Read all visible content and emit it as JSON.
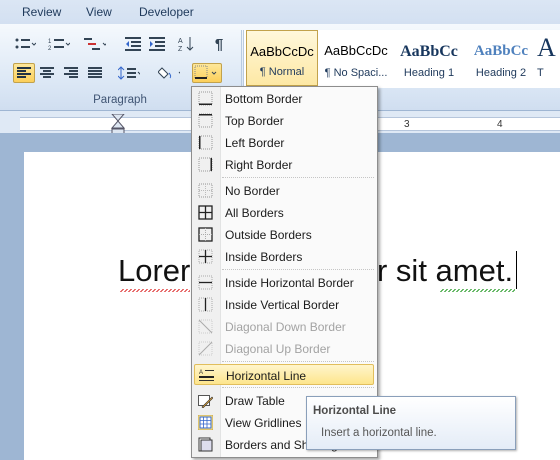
{
  "ribbon": {
    "tabs": [
      "Review",
      "View",
      "Developer"
    ],
    "paragraph_group_label": "Paragraph",
    "styles": [
      {
        "sample": "AaBbCcDc",
        "name": "¶ Normal",
        "selected": true
      },
      {
        "sample": "AaBbCcDc",
        "name": "¶ No Spaci...",
        "selected": false
      },
      {
        "sample": "AaBbCc",
        "name": "Heading 1",
        "selected": false
      },
      {
        "sample": "AaBbCc",
        "name": "Heading 2",
        "selected": false
      },
      {
        "sample": "A",
        "name": "T",
        "selected": false
      }
    ],
    "colors": {
      "heading": "#17365d",
      "heading2": "#4f81bd"
    }
  },
  "ruler": {
    "numbers": [
      "1",
      "3",
      "4"
    ]
  },
  "document": {
    "text_left": "Lorer",
    "text_right": "r sit amet."
  },
  "borders_menu": {
    "items": [
      {
        "label": "Bottom Border",
        "icon": "bottom-border-icon",
        "disabled": false
      },
      {
        "label": "Top Border",
        "icon": "top-border-icon",
        "disabled": false
      },
      {
        "label": "Left Border",
        "icon": "left-border-icon",
        "disabled": false
      },
      {
        "label": "Right Border",
        "icon": "right-border-icon",
        "disabled": false
      },
      {
        "label": "No Border",
        "icon": "no-border-icon",
        "disabled": false
      },
      {
        "label": "All Borders",
        "icon": "all-borders-icon",
        "disabled": false
      },
      {
        "label": "Outside Borders",
        "icon": "outside-borders-icon",
        "disabled": false
      },
      {
        "label": "Inside Borders",
        "icon": "inside-borders-icon",
        "disabled": false
      },
      {
        "label": "Inside Horizontal Border",
        "icon": "inside-horizontal-border-icon",
        "disabled": false
      },
      {
        "label": "Inside Vertical Border",
        "icon": "inside-vertical-border-icon",
        "disabled": false
      },
      {
        "label": "Diagonal Down Border",
        "icon": "diagonal-down-border-icon",
        "disabled": true
      },
      {
        "label": "Diagonal Up Border",
        "icon": "diagonal-up-border-icon",
        "disabled": true
      },
      {
        "label": "Horizontal Line",
        "icon": "horizontal-line-icon",
        "disabled": false,
        "highlighted": true
      },
      {
        "label": "Draw Table",
        "icon": "draw-table-icon",
        "disabled": false
      },
      {
        "label": "View Gridlines",
        "icon": "view-gridlines-icon",
        "disabled": false
      },
      {
        "label": "Borders and Shading...",
        "icon": "borders-and-shading-icon",
        "disabled": false
      }
    ]
  },
  "tooltip": {
    "title": "Horizontal Line",
    "description": "Insert a horizontal line."
  }
}
